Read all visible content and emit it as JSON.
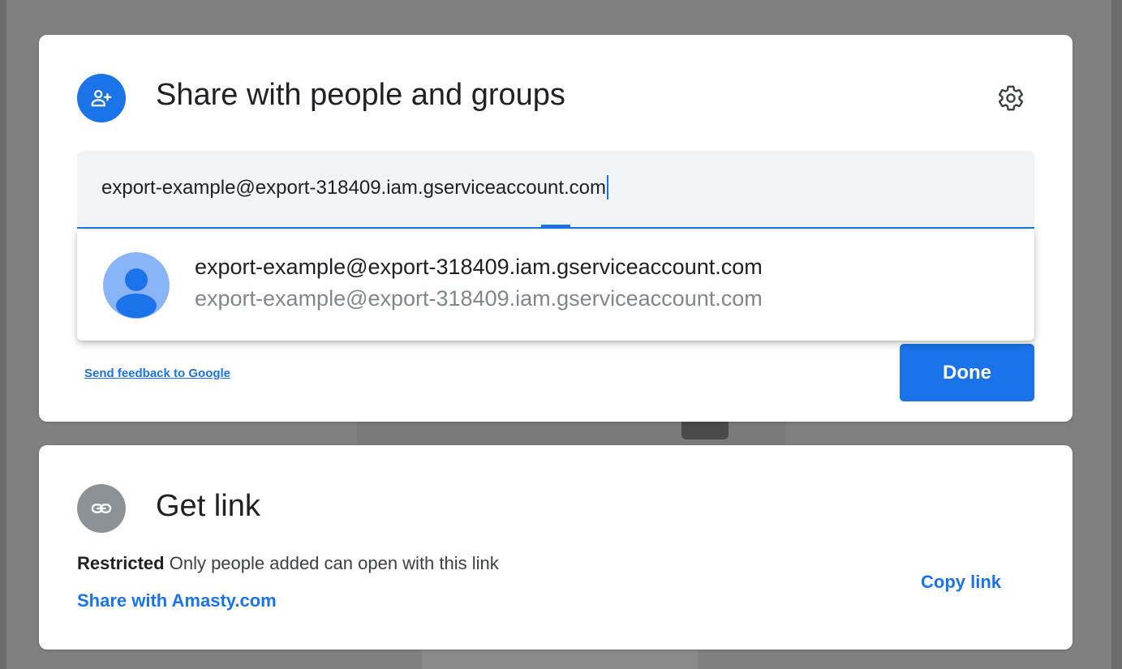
{
  "share_panel": {
    "title": "Share with people and groups",
    "icon": "person-add-icon",
    "settings_icon": "gear-icon",
    "input": {
      "value": "export-example@export-318409.iam.gserviceaccount.com"
    },
    "suggestion": {
      "icon": "avatar-icon",
      "name": "export-example@export-318409.iam.gserviceaccount.com",
      "email": "export-example@export-318409.iam.gserviceaccount.com"
    },
    "feedback_link": "Send feedback to Google",
    "done_label": "Done"
  },
  "link_panel": {
    "title": "Get link",
    "icon": "link-icon",
    "access_level": "Restricted",
    "access_description": "Only people added can open with this link",
    "share_with_domain": "Share with Amasty.com",
    "copy_link_label": "Copy link"
  },
  "colors": {
    "accent": "#1a73e8",
    "overlay": "#808080",
    "link_icon_bg": "#8c9196"
  }
}
